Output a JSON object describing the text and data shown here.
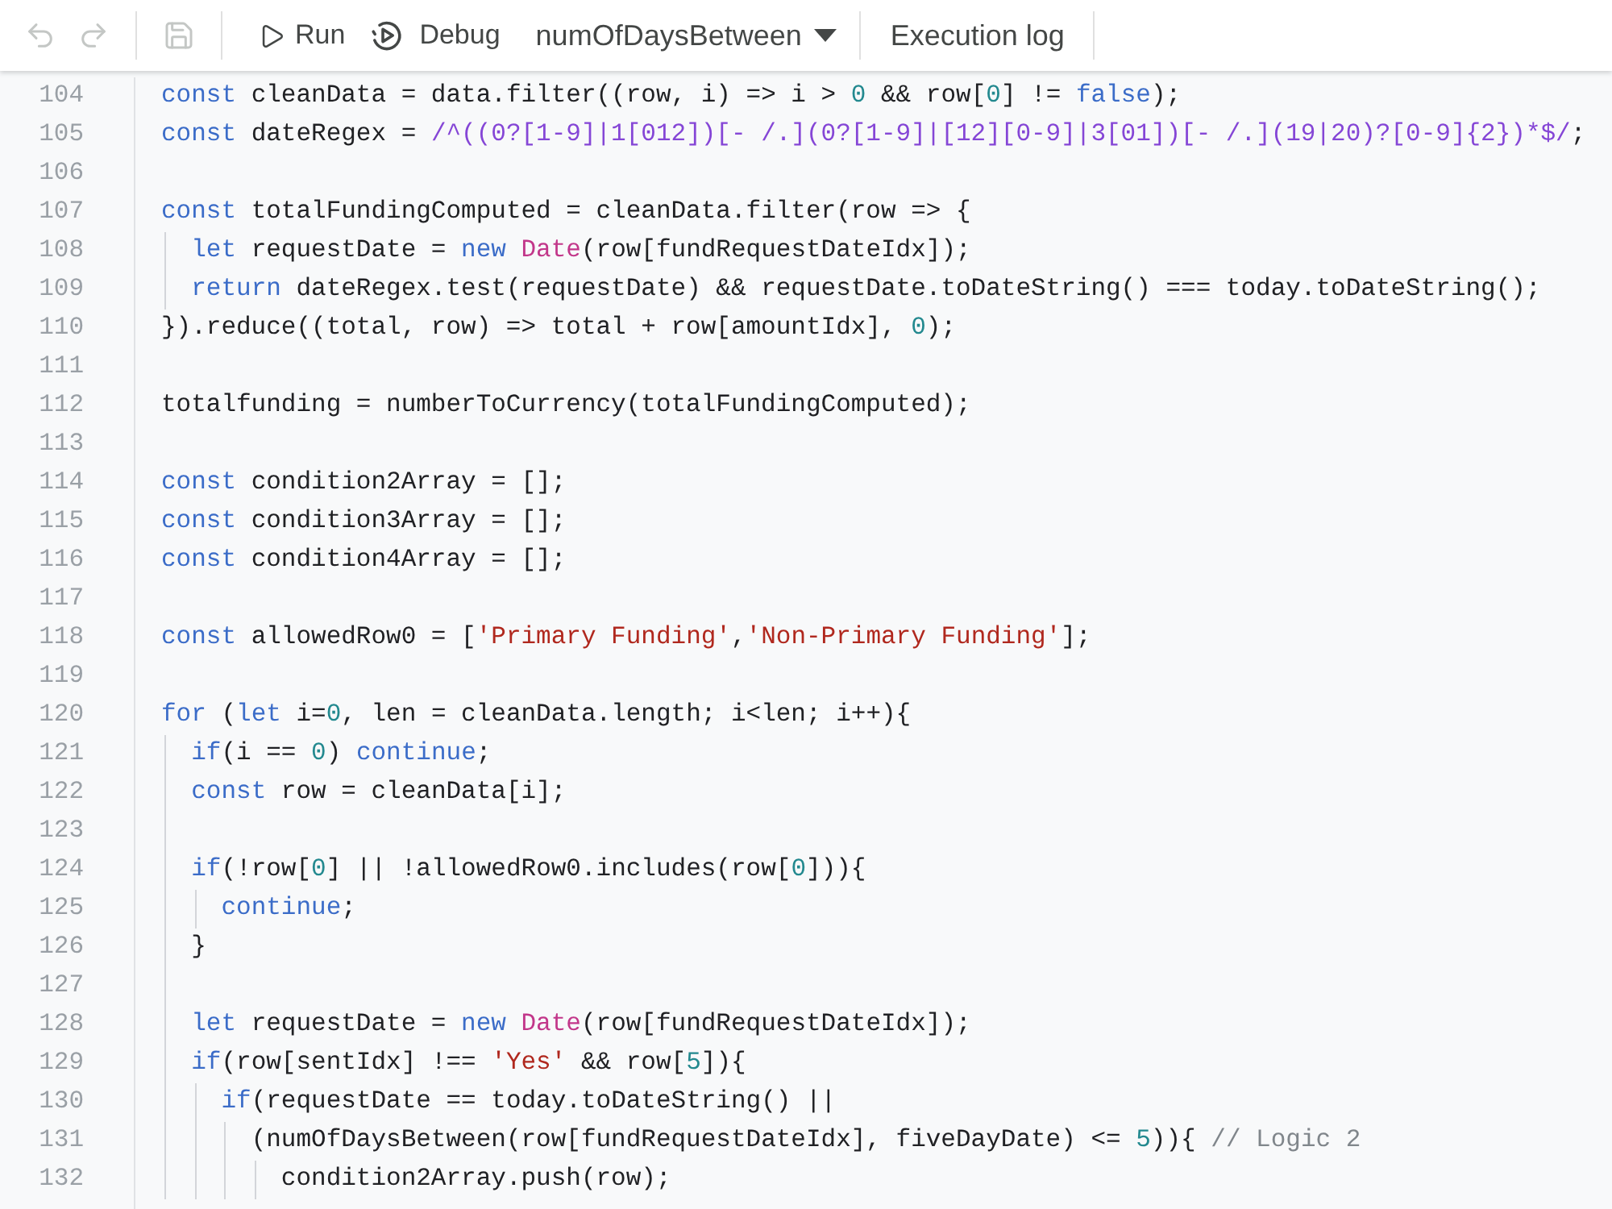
{
  "toolbar": {
    "icon_buttons": [
      {
        "kind": "undo",
        "disabled": true
      },
      {
        "kind": "redo",
        "disabled": true
      },
      {
        "kind": "save",
        "disabled": true
      }
    ],
    "actions": [
      {
        "kind": "run",
        "label": "Run"
      },
      {
        "kind": "debug",
        "label": "Debug"
      }
    ],
    "function_select": {
      "value": "numOfDaysBetween"
    },
    "execution_log": {
      "label": "Execution log"
    }
  },
  "editor": {
    "lines": [
      {
        "number": "104",
        "tokens": [
          {
            "kind": "keyword",
            "text": "const"
          },
          {
            "kind": "plain",
            "text": " cleanData = data.filter((row, i) => i > "
          },
          {
            "kind": "number",
            "text": "0"
          },
          {
            "kind": "plain",
            "text": " && row["
          },
          {
            "kind": "number",
            "text": "0"
          },
          {
            "kind": "plain",
            "text": "] != "
          },
          {
            "kind": "keyword",
            "text": "false"
          },
          {
            "kind": "plain",
            "text": ");"
          }
        ]
      },
      {
        "number": "105",
        "tokens": [
          {
            "kind": "keyword",
            "text": "const"
          },
          {
            "kind": "plain",
            "text": " dateRegex = "
          },
          {
            "kind": "regex",
            "text": "/^((0?[1-9]|1[012])[- /.](0?[1-9]|[12][0-9]|3[01])[- /.](19|20)?[0-9]{2})*$/"
          },
          {
            "kind": "plain",
            "text": ";"
          }
        ]
      },
      {
        "number": "106"
      },
      {
        "number": "107",
        "tokens": [
          {
            "kind": "keyword",
            "text": "const"
          },
          {
            "kind": "plain",
            "text": " totalFundingComputed = cleanData.filter(row => {"
          }
        ]
      },
      {
        "number": "108",
        "tokens": [
          {
            "kind": "keyword",
            "text": "  let"
          },
          {
            "kind": "plain",
            "text": " requestDate = "
          },
          {
            "kind": "keyword",
            "text": "new"
          },
          {
            "kind": "type",
            "text": " Date"
          },
          {
            "kind": "plain",
            "text": "(row[fundRequestDateIdx]);"
          }
        ]
      },
      {
        "number": "109",
        "tokens": [
          {
            "kind": "keyword",
            "text": "  return"
          },
          {
            "kind": "plain",
            "text": " dateRegex.test(requestDate) && requestDate.toDateString() === today.toDateString();"
          }
        ]
      },
      {
        "number": "110",
        "tokens": [
          {
            "kind": "plain",
            "text": "}).reduce((total, row) => total + row[amountIdx], "
          },
          {
            "kind": "number",
            "text": "0"
          },
          {
            "kind": "plain",
            "text": ");"
          }
        ]
      },
      {
        "number": "111"
      },
      {
        "number": "112",
        "tokens": [
          {
            "kind": "plain",
            "text": "totalfunding = numberToCurrency(totalFundingComputed);"
          }
        ]
      },
      {
        "number": "113"
      },
      {
        "number": "114",
        "tokens": [
          {
            "kind": "keyword",
            "text": "const"
          },
          {
            "kind": "plain",
            "text": " condition2Array = [];"
          }
        ]
      },
      {
        "number": "115",
        "tokens": [
          {
            "kind": "keyword",
            "text": "const"
          },
          {
            "kind": "plain",
            "text": " condition3Array = [];"
          }
        ]
      },
      {
        "number": "116",
        "tokens": [
          {
            "kind": "keyword",
            "text": "const"
          },
          {
            "kind": "plain",
            "text": " condition4Array = [];"
          }
        ]
      },
      {
        "number": "117"
      },
      {
        "number": "118",
        "tokens": [
          {
            "kind": "keyword",
            "text": "const"
          },
          {
            "kind": "plain",
            "text": " allowedRow0 = ["
          },
          {
            "kind": "string",
            "text": "'Primary Funding'"
          },
          {
            "kind": "plain",
            "text": ","
          },
          {
            "kind": "string",
            "text": "'Non-Primary Funding'"
          },
          {
            "kind": "plain",
            "text": "];"
          }
        ]
      },
      {
        "number": "119"
      },
      {
        "number": "120",
        "tokens": [
          {
            "kind": "keyword",
            "text": "for"
          },
          {
            "kind": "plain",
            "text": " ("
          },
          {
            "kind": "keyword",
            "text": "let"
          },
          {
            "kind": "plain",
            "text": " i="
          },
          {
            "kind": "number",
            "text": "0"
          },
          {
            "kind": "plain",
            "text": ", len = cleanData.length; i<len; i++){"
          }
        ]
      },
      {
        "number": "121",
        "tokens": [
          {
            "kind": "keyword",
            "text": "  if"
          },
          {
            "kind": "plain",
            "text": "(i == "
          },
          {
            "kind": "number",
            "text": "0"
          },
          {
            "kind": "plain",
            "text": ") "
          },
          {
            "kind": "keyword",
            "text": "continue"
          },
          {
            "kind": "plain",
            "text": ";"
          }
        ]
      },
      {
        "number": "122",
        "tokens": [
          {
            "kind": "keyword",
            "text": "  const"
          },
          {
            "kind": "plain",
            "text": " row = cleanData[i];"
          }
        ]
      },
      {
        "number": "123"
      },
      {
        "number": "124",
        "tokens": [
          {
            "kind": "keyword",
            "text": "  if"
          },
          {
            "kind": "plain",
            "text": "(!row["
          },
          {
            "kind": "number",
            "text": "0"
          },
          {
            "kind": "plain",
            "text": "] || !allowedRow0.includes(row["
          },
          {
            "kind": "number",
            "text": "0"
          },
          {
            "kind": "plain",
            "text": "])){"
          }
        ]
      },
      {
        "number": "125",
        "tokens": [
          {
            "kind": "keyword",
            "text": "    continue"
          },
          {
            "kind": "plain",
            "text": ";"
          }
        ]
      },
      {
        "number": "126",
        "tokens": [
          {
            "kind": "plain",
            "text": "  }"
          }
        ]
      },
      {
        "number": "127"
      },
      {
        "number": "128",
        "tokens": [
          {
            "kind": "keyword",
            "text": "  let"
          },
          {
            "kind": "plain",
            "text": " requestDate = "
          },
          {
            "kind": "keyword",
            "text": "new"
          },
          {
            "kind": "type",
            "text": " Date"
          },
          {
            "kind": "plain",
            "text": "(row[fundRequestDateIdx]);"
          }
        ]
      },
      {
        "number": "129",
        "tokens": [
          {
            "kind": "keyword",
            "text": "  if"
          },
          {
            "kind": "plain",
            "text": "(row[sentIdx] !== "
          },
          {
            "kind": "string",
            "text": "'Yes'"
          },
          {
            "kind": "plain",
            "text": " && row["
          },
          {
            "kind": "number",
            "text": "5"
          },
          {
            "kind": "plain",
            "text": "]){"
          }
        ]
      },
      {
        "number": "130",
        "tokens": [
          {
            "kind": "keyword",
            "text": "    if"
          },
          {
            "kind": "plain",
            "text": "(requestDate == today.toDateString() ||"
          }
        ]
      },
      {
        "number": "131",
        "tokens": [
          {
            "kind": "plain",
            "text": "      (numOfDaysBetween(row[fundRequestDateIdx], fiveDayDate) <= "
          },
          {
            "kind": "number",
            "text": "5"
          },
          {
            "kind": "plain",
            "text": ")){ "
          },
          {
            "kind": "comment",
            "text": "// Logic 2"
          }
        ]
      },
      {
        "number": "132",
        "tokens": [
          {
            "kind": "plain",
            "text": "        condition2Array.push(row);"
          }
        ]
      }
    ]
  }
}
